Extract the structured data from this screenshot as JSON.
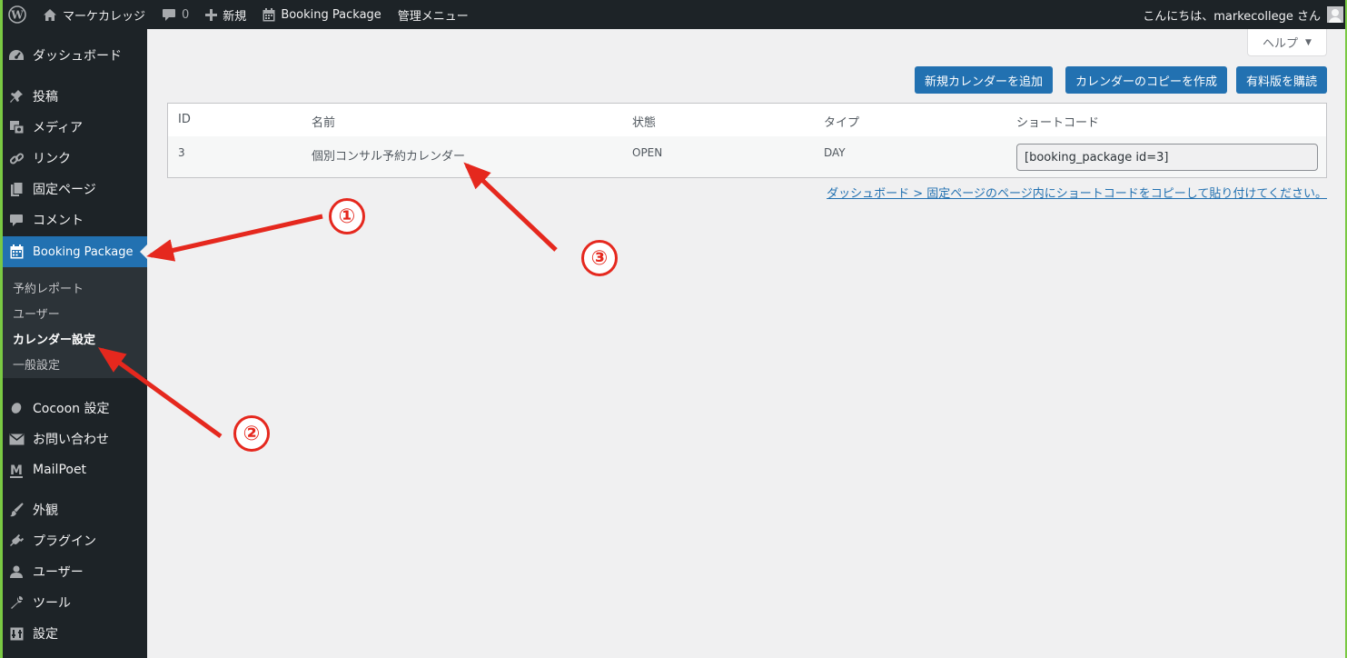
{
  "adminbar": {
    "site_name": "マーケカレッジ",
    "comments_count": "0",
    "new_label": "新規",
    "plugin_label": "Booking Package",
    "admin_menu_label": "管理メニュー",
    "greeting": "こんにちは、markecollege さん"
  },
  "sidebar": {
    "dashboard": "ダッシュボード",
    "posts": "投稿",
    "media": "メディア",
    "links": "リンク",
    "pages": "固定ページ",
    "comments": "コメント",
    "booking": "Booking Package",
    "submenu": [
      "予約レポート",
      "ユーザー",
      "カレンダー設定",
      "一般設定"
    ],
    "cocoon": "Cocoon 設定",
    "contact": "お問い合わせ",
    "mailpoet": "MailPoet",
    "appearance": "外観",
    "plugins": "プラグイン",
    "users": "ユーザー",
    "tools": "ツール",
    "settings": "設定"
  },
  "help_label": "ヘルプ",
  "buttons": {
    "add_calendar": "新規カレンダーを追加",
    "copy_calendar": "カレンダーのコピーを作成",
    "buy_paid": "有料版を購読"
  },
  "table": {
    "headers": [
      "ID",
      "名前",
      "状態",
      "タイプ",
      "ショートコード"
    ],
    "rows": [
      {
        "id": "3",
        "name": "個別コンサル予約カレンダー",
        "status": "OPEN",
        "type": "DAY",
        "shortcode": "[booking_package id=3]"
      }
    ]
  },
  "note": "ダッシュボード > 固定ページのページ内にショートコードをコピーして貼り付けてください。",
  "annotations": {
    "badge1": "①",
    "badge2": "②",
    "badge3": "③",
    "color": "#e5281e"
  }
}
